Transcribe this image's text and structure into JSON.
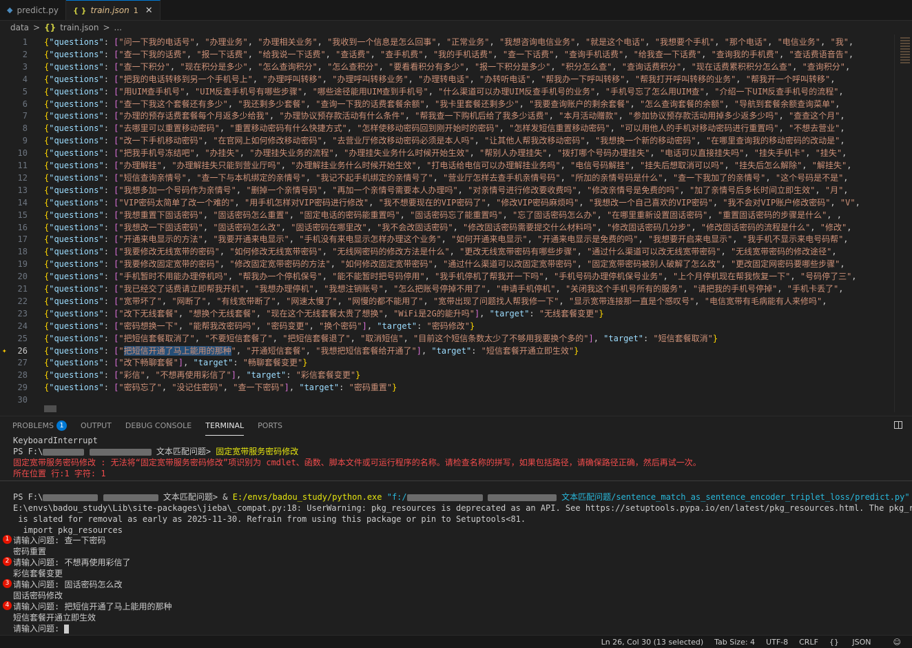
{
  "tabs": [
    {
      "name": "predict.py",
      "icon": "python-icon"
    },
    {
      "name": "train.json",
      "icon": "json-icon",
      "badge": "1",
      "close": "✕"
    }
  ],
  "breadcrumb": {
    "folder": "data",
    "sep": ">",
    "json_icon": "{}",
    "file": "train.json",
    "more": "..."
  },
  "editor": {
    "current_line": 26,
    "selection": "把短信开通了马上能用的那种",
    "lines": [
      {
        "n": "1",
        "q": [
          "问一下我的电话号",
          "办理业务",
          "办理相关业务",
          "我收到一个信息是怎么回事",
          "正常业务",
          "我想咨询电信业务",
          "就是这个电话",
          "我想要个手机",
          "那个电话",
          "电信业务",
          "我"
        ],
        "t": "",
        "more": true
      },
      {
        "n": "2",
        "q": [
          "查一下我的话费",
          "报一下话费",
          "给我说一下话费",
          "查话费",
          "查手机费",
          "我的手机话费",
          "查一下话费",
          "查询手机话费",
          "给我查一下话费",
          "查询我的手机费",
          "查话费语音告"
        ],
        "t": "",
        "more": true
      },
      {
        "n": "3",
        "q": [
          "查一下积分",
          "现在积分是多少",
          "怎么查询积分",
          "怎么查积分",
          "要看看积分有多少",
          "报一下积分是多少",
          "积分怎么查",
          "查询话费积分",
          "现在话费累积积分怎么查",
          "查询积分"
        ],
        "t": "",
        "more": true
      },
      {
        "n": "4",
        "q": [
          "把我的电话转移到另一个手机号上",
          "办理呼叫转移",
          "办理呼叫转移业务",
          "办理转电话",
          "办转听电话",
          "帮我办一下呼叫转移",
          "帮我打开呼叫转移的业务",
          "帮我开一个呼叫转移"
        ],
        "t": "",
        "more": true
      },
      {
        "n": "5",
        "q": [
          "用UIM查手机号",
          "UIM反查手机号有哪些步骤",
          "哪些途径能用UIM查到手机号",
          "什么渠道可以办理UIM反查手机号的业务",
          "手机号忘了怎么用UIM查",
          "介绍一下UIM反查手机号的流程"
        ],
        "t": "",
        "more": true
      },
      {
        "n": "6",
        "q": [
          "查一下我这个套餐还有多少",
          "我还剩多少套餐",
          "查询一下我的话费套餐余额",
          "我卡里套餐还剩多少",
          "我要查询账户的剩余套餐",
          "怎么查询套餐的余额",
          "导航到套餐余额查询菜单"
        ],
        "t": "",
        "more": true
      },
      {
        "n": "7",
        "q": [
          "办理的预存话费套餐每个月返多少给我",
          "办理协议预存款活动有什么条件",
          "帮我查一下购机后给了我多少话费",
          "本月活动赠款",
          "参加协议预存款活动用掉多少返多少吗",
          "查查这个月"
        ],
        "t": "",
        "more": true
      },
      {
        "n": "8",
        "q": [
          "去哪里可以重置移动密码",
          "重置移动密码有什么快捷方式",
          "怎样使移动密码回到刚开始时的密码",
          "怎样发短信重置移动密码",
          "可以用他人的手机对移动密码进行重置吗",
          "不想去营业"
        ],
        "t": "",
        "more": true
      },
      {
        "n": "9",
        "q": [
          "改一下手机移动密码",
          "在官网上如何修改移动密码",
          "去营业厅修改移动密码必须是本人吗",
          "让其他人帮我改移动密码",
          "我想换一个新的移动密码",
          "在哪里查询我的移动密码的改动是"
        ],
        "t": "",
        "more": true
      },
      {
        "n": "10",
        "q": [
          "把我手机号冻结吧",
          "办挂失",
          "办理挂失业务的流程",
          "办理挂失业务什么时候开始生效",
          "帮别人办理挂失",
          "拨打哪个号码办理挂失",
          "电话可以直接挂失吗",
          "挂失手机卡",
          "挂失"
        ],
        "t": "",
        "more": true
      },
      {
        "n": "11",
        "q": [
          "办理解挂",
          "办理解挂失只能到营业厅吗",
          "办理解挂业务什么时候开始生效",
          "打电话给电信可以办理解挂业务吗",
          "电信号码解挂",
          "挂失后想取消可以吗",
          "挂失后怎么解除",
          "解挂失"
        ],
        "t": "",
        "more": true
      },
      {
        "n": "12",
        "q": [
          "短信查询亲情号",
          "查一下与本机绑定的亲情号",
          "我记不起手机绑定的亲情号了",
          "营业厅怎样去查手机亲情号码",
          "所加的亲情号码是什么",
          "查一下我加了的亲情号",
          "这个号码是不是"
        ],
        "t": "",
        "more": true
      },
      {
        "n": "13",
        "q": [
          "我想多加一个号码作为亲情号",
          "删掉一个亲情号码",
          "再加一个亲情号需要本人办理吗",
          "对亲情号进行修改要收费吗",
          "修改亲情号是免费的吗",
          "加了亲情号后多长时间立即生效",
          "月"
        ],
        "t": "",
        "more": true
      },
      {
        "n": "14",
        "q": [
          "VIP密码太简单了改一个难的",
          "用手机怎样对VIP密码进行修改",
          "我不想要现在的VIP密码了",
          "修改VIP密码麻烦吗",
          "我想改一个自己喜欢的VIP密码",
          "我不会对VIP账户修改密码",
          "V"
        ],
        "t": "",
        "more": true
      },
      {
        "n": "15",
        "q": [
          "我想重置下固话密码",
          "固话密码怎么重置",
          "固定电话的密码能重置吗",
          "固话密码忘了能重置吗",
          "忘了固话密码怎么办",
          "在哪里重新设置固话密码",
          "重置固话密码的步骤是什么",
          ""
        ],
        "t": "",
        "more": true
      },
      {
        "n": "16",
        "q": [
          "我想改一下固话密码",
          "固话密码怎么改",
          "固话密码在哪里改",
          "我不会改固话密码",
          "修改固话密码需要提交什么材料吗",
          "修改固话密码几分步",
          "修改固话密码的流程是什么",
          "修改"
        ],
        "t": "",
        "more": true
      },
      {
        "n": "17",
        "q": [
          "开通来电显示的方法",
          "我要开通来电显示",
          "手机没有来电显示怎样办理这个业务",
          "如何开通来电显示",
          "开通来电显示是免费的吗",
          "我想要开启来电显示",
          "我手机不显示来电号码帮"
        ],
        "t": "",
        "more": true
      },
      {
        "n": "18",
        "q": [
          "我要修改无线宽带的密码",
          "如何修改无线宽带密码",
          "无线网密码的修改方法是什么",
          "更改无线宽带密码有哪些步骤",
          "通过什么渠道可以改无线宽带密码",
          "无线宽带密码的修改途径"
        ],
        "t": "",
        "more": true
      },
      {
        "n": "19",
        "q": [
          "我要修改固定宽带的密码",
          "修改固定宽带密码的方法",
          "如何修改固定宽带密码",
          "通过什么渠道可以改固定宽带密码",
          "固定宽带密码被别人破解了怎么改",
          "更改固定网密码要哪些步骤"
        ],
        "t": "",
        "more": true
      },
      {
        "n": "20",
        "q": [
          "手机暂时不用能办理停机吗",
          "帮我办一个停机保号",
          "能不能暂时把号码停用",
          "我手机停机了帮我开一下吗",
          "手机号码办理停机保号业务",
          "上个月停机现在帮我恢复一下",
          "号码停了三"
        ],
        "t": "",
        "more": true
      },
      {
        "n": "21",
        "q": [
          "我已经交了话费请立即帮我开机",
          "我想办理停机",
          "我想注销账号",
          "怎么把账号停掉不用了",
          "申请手机停机",
          "关闭我这个手机号所有的服务",
          "请把我的手机号停掉",
          "手机卡丢了"
        ],
        "t": "",
        "more": true
      },
      {
        "n": "22",
        "q": [
          "宽带坏了",
          "网断了",
          "有线宽带断了",
          "网速太慢了",
          "网慢的都不能用了",
          "宽带出现了问题找人帮我修一下",
          "显示宽带连接那一直是个感叹号",
          "电信宽带有毛病能有人来修吗"
        ],
        "t": "",
        "more": true
      },
      {
        "n": "23",
        "q": [
          "改下无线套餐",
          "想换个无线套餐",
          "现在这个无线套餐太贵了想换",
          "WiFi是2G的能升吗"
        ],
        "t": "无线套餐变更",
        "more": false
      },
      {
        "n": "24",
        "q": [
          "密码想换一下",
          "能帮我改密码吗",
          "密码变更",
          "换个密码"
        ],
        "t": "密码修改",
        "more": false
      },
      {
        "n": "25",
        "q": [
          "把短信套餐取消了",
          "不要短信套餐了",
          "把短信套餐退了",
          "取消短信",
          "目前这个短信条数太少了不够用我要换个多的"
        ],
        "t": "短信套餐取消",
        "more": false
      },
      {
        "n": "26",
        "q": [
          "把短信开通了马上能用的那种",
          "开通短信套餐",
          "我想把短信套餐给开通了"
        ],
        "t": "短信套餐开通立即生效",
        "more": false
      },
      {
        "n": "27",
        "q": [
          "改下畅聊套餐"
        ],
        "t": "畅聊套餐变更",
        "more": false
      },
      {
        "n": "28",
        "q": [
          "彩信",
          "不想再使用彩信了"
        ],
        "t": "彩信套餐变更",
        "more": false
      },
      {
        "n": "29",
        "q": [
          "密码忘了",
          "没记住密码",
          "查一下密码"
        ],
        "t": "密码重置",
        "more": false
      },
      {
        "n": "30",
        "q": [],
        "t": "",
        "more": false
      }
    ]
  },
  "panel": {
    "tabs": [
      {
        "label": "PROBLEMS",
        "badge": "1"
      },
      {
        "label": "OUTPUT"
      },
      {
        "label": "DEBUG CONSOLE"
      },
      {
        "label": "TERMINAL",
        "active": true
      },
      {
        "label": "PORTS"
      }
    ]
  },
  "terminal": {
    "l1": "KeyboardInterrupt",
    "l2_prefix": "PS F:\\",
    "l2_mid": "文本匹配问题>",
    "l2_cmd": "固定宽带服务密码修改",
    "l3": "固定宽带服务密码修改 : 无法将“固定宽带服务密码修改”项识别为 cmdlet、函数、脚本文件或可运行程序的名称。请检查名称的拼写，如果包括路径，请确保路径正确，然后再试一次。",
    "l4": "所在位置 行:1 字符: 1",
    "l5_prefix": "PS F:\\",
    "l5_mid": "文本匹配问题> &",
    "l5_exe": "E:/envs/badou_study/python.exe",
    "l5_arg1": "\"f:/",
    "l5_arg2": "文本匹配问题/sentence_match_as_sentence_encoder_triplet_loss/predict.py\"",
    "l6": "E:\\envs\\badou_study\\Lib\\site-packages\\jieba\\_compat.py:18: UserWarning: pkg_resources is deprecated as an API. See https://setuptools.pypa.io/en/latest/pkg_resources.html. The pkg_resources package",
    "l7": " is slated for removal as early as 2025-11-30. Refrain from using this package or pin to Setuptools<81.",
    "l8": "  import pkg_resources",
    "qa": [
      {
        "num": "1",
        "q": "请输入问题: 查一下密码",
        "a": "密码重置"
      },
      {
        "num": "2",
        "q": "请输入问题: 不想再使用彩信了",
        "a": "彩信套餐变更"
      },
      {
        "num": "3",
        "q": "请输入问题: 固话密码怎么改",
        "a": "固话密码修改"
      },
      {
        "num": "4",
        "q": "请输入问题: 把短信开通了马上能用的那种",
        "a": "短信套餐开通立即生效"
      }
    ],
    "prompt": "请输入问题:"
  },
  "status": {
    "position": "Ln 26, Col 30 (13 selected)",
    "tab_size": "Tab Size: 4",
    "encoding": "UTF-8",
    "eol": "CRLF",
    "lang_icon": "{}",
    "language": "JSON",
    "account_icon": "copilot-icon"
  }
}
